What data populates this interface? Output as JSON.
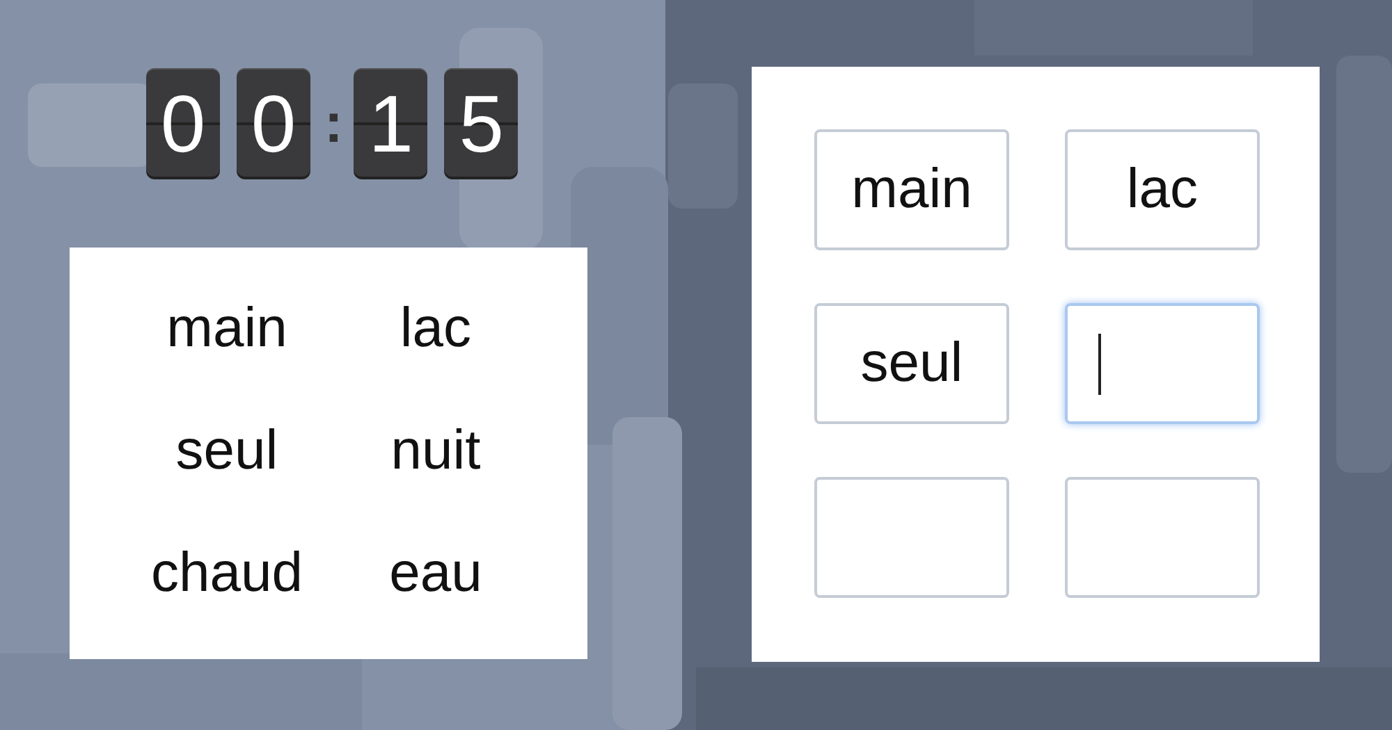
{
  "timer": {
    "digits": [
      "0",
      "0",
      "1",
      "5"
    ],
    "separator": ":"
  },
  "word_list": [
    "main",
    "lac",
    "seul",
    "nuit",
    "chaud",
    "eau"
  ],
  "answers": [
    {
      "value": "main",
      "focused": false
    },
    {
      "value": "lac",
      "focused": false
    },
    {
      "value": "seul",
      "focused": false
    },
    {
      "focused": true
    },
    {
      "focused": false
    },
    {
      "focused": false
    }
  ]
}
